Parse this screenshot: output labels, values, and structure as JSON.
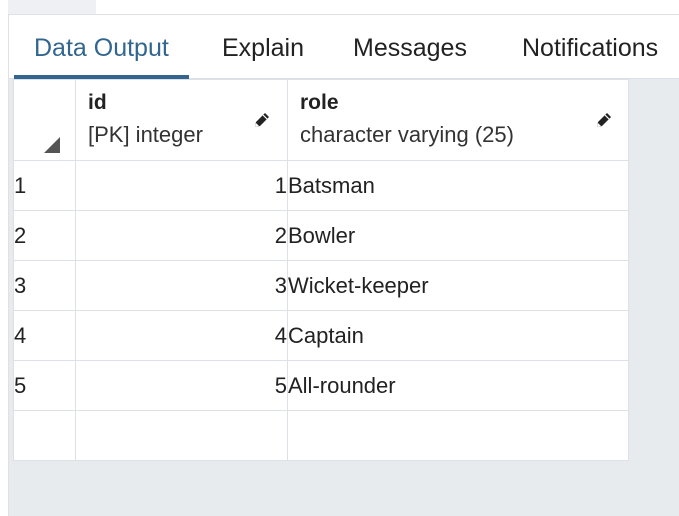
{
  "tabs": [
    {
      "label": "Data Output",
      "active": true
    },
    {
      "label": "Explain",
      "active": false
    },
    {
      "label": "Messages",
      "active": false
    },
    {
      "label": "Notifications",
      "active": false
    }
  ],
  "columns": [
    {
      "name": "id",
      "type": "[PK] integer",
      "icon": "pencil-icon"
    },
    {
      "name": "role",
      "type": "character varying (25)",
      "icon": "pencil-icon"
    }
  ],
  "rows": [
    {
      "num": "1",
      "id": "1",
      "role": "Batsman"
    },
    {
      "num": "2",
      "id": "2",
      "role": "Bowler"
    },
    {
      "num": "3",
      "id": "3",
      "role": "Wicket-keeper"
    },
    {
      "num": "4",
      "id": "4",
      "role": "Captain"
    },
    {
      "num": "5",
      "id": "5",
      "role": "All-rounder"
    }
  ],
  "colors": {
    "accent": "#326690",
    "border": "#dde0e6",
    "empty_area": "#e8ebee"
  }
}
